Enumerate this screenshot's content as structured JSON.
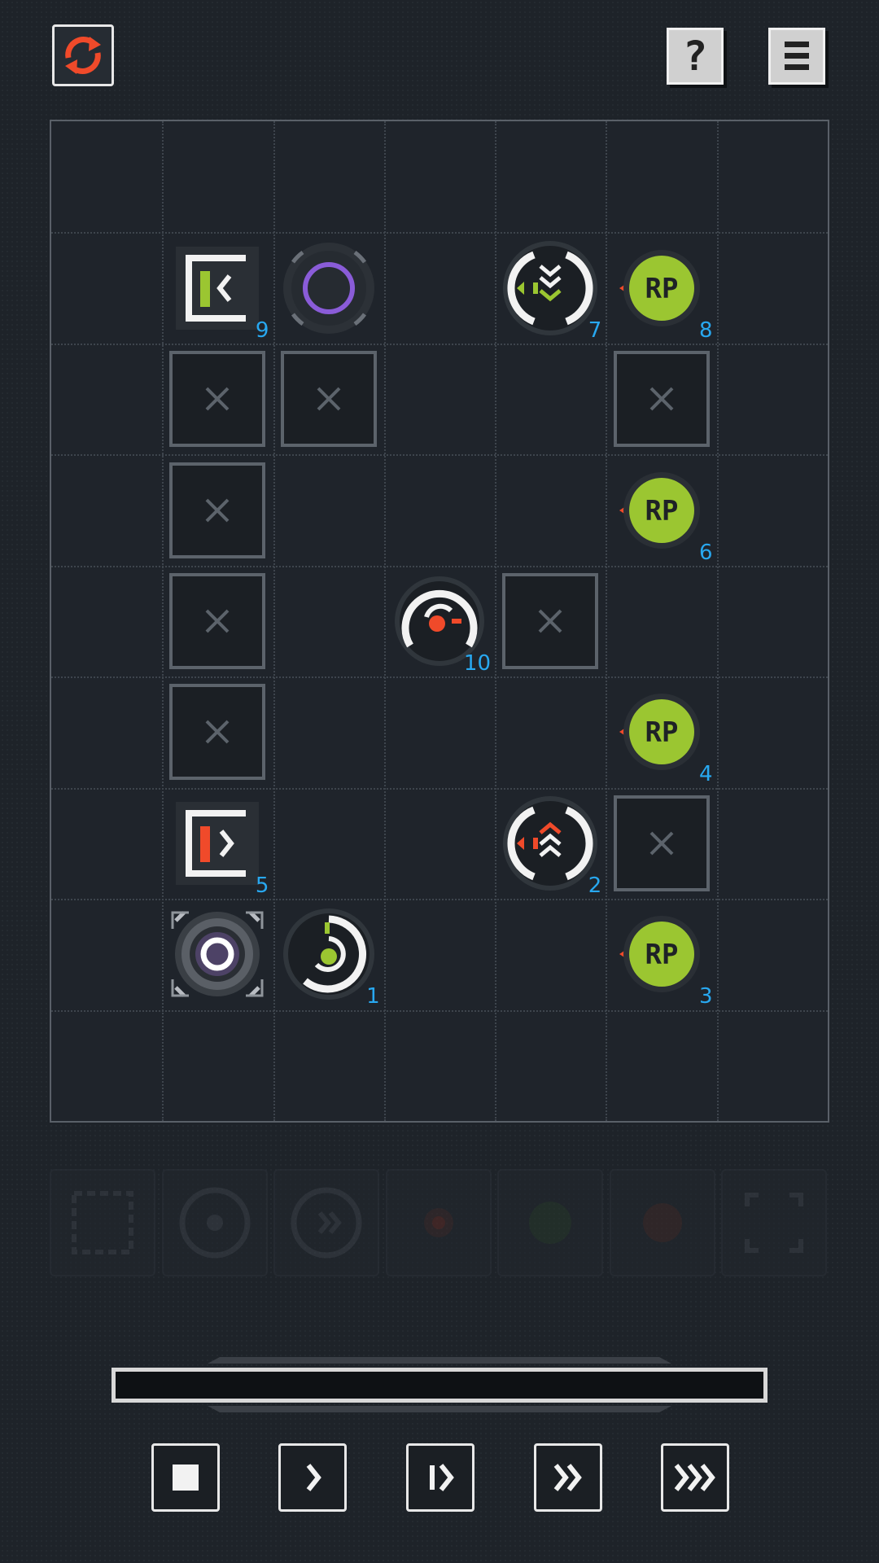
{
  "toolbar": {
    "restart_icon": "restart-arrows-icon",
    "help_label": "?",
    "menu_icon": "hamburger-menu-icon"
  },
  "board": {
    "columns": 7,
    "rows": 9,
    "pieces": [
      {
        "type": "bracket-green",
        "col": 1,
        "row": 1,
        "index": "9"
      },
      {
        "type": "purple-ring",
        "col": 2,
        "row": 1,
        "index": ""
      },
      {
        "type": "chevron-down-green",
        "col": 4,
        "row": 1,
        "index": "7"
      },
      {
        "type": "rp",
        "col": 5,
        "row": 1,
        "index": "8",
        "label": "RP"
      },
      {
        "type": "blocked",
        "col": 1,
        "row": 2,
        "index": ""
      },
      {
        "type": "blocked",
        "col": 2,
        "row": 2,
        "index": ""
      },
      {
        "type": "blocked",
        "col": 5,
        "row": 2,
        "index": ""
      },
      {
        "type": "blocked",
        "col": 1,
        "row": 3,
        "index": ""
      },
      {
        "type": "rp",
        "col": 5,
        "row": 3,
        "index": "6",
        "label": "RP"
      },
      {
        "type": "blocked",
        "col": 1,
        "row": 4,
        "index": ""
      },
      {
        "type": "dial-red",
        "col": 3,
        "row": 4,
        "index": "10"
      },
      {
        "type": "blocked",
        "col": 4,
        "row": 4,
        "index": ""
      },
      {
        "type": "blocked",
        "col": 1,
        "row": 5,
        "index": ""
      },
      {
        "type": "rp",
        "col": 5,
        "row": 5,
        "index": "4",
        "label": "RP"
      },
      {
        "type": "bracket-red",
        "col": 1,
        "row": 6,
        "index": "5"
      },
      {
        "type": "chevron-up-red",
        "col": 4,
        "row": 6,
        "index": "2"
      },
      {
        "type": "blocked",
        "col": 5,
        "row": 6,
        "index": ""
      },
      {
        "type": "start-node",
        "col": 1,
        "row": 7,
        "index": ""
      },
      {
        "type": "dial-green",
        "col": 2,
        "row": 7,
        "index": "1"
      },
      {
        "type": "rp",
        "col": 5,
        "row": 7,
        "index": "3",
        "label": "RP"
      }
    ]
  },
  "palette": [
    {
      "icon": "bracket-tool-icon"
    },
    {
      "icon": "dial-tool-icon"
    },
    {
      "icon": "chevron-tool-icon"
    },
    {
      "icon": "red-node-tool-icon"
    },
    {
      "icon": "green-node-tool-icon"
    },
    {
      "icon": "red-dot-tool-icon"
    },
    {
      "icon": "corner-frame-tool-icon"
    }
  ],
  "progress": {
    "value": 0
  },
  "controls": [
    {
      "name": "stop-button",
      "icon": "stop-icon"
    },
    {
      "name": "step-button",
      "icon": "step-icon"
    },
    {
      "name": "play-button",
      "icon": "play-icon"
    },
    {
      "name": "fast-forward-button",
      "icon": "fast-forward-icon"
    },
    {
      "name": "fastest-button",
      "icon": "fastest-icon"
    }
  ],
  "colors": {
    "background": "#1e2329",
    "index_blue": "#28a8f0",
    "rp_green": "#9bc631",
    "accent_red": "#f04a2a",
    "purple": "#8a5cd8"
  }
}
